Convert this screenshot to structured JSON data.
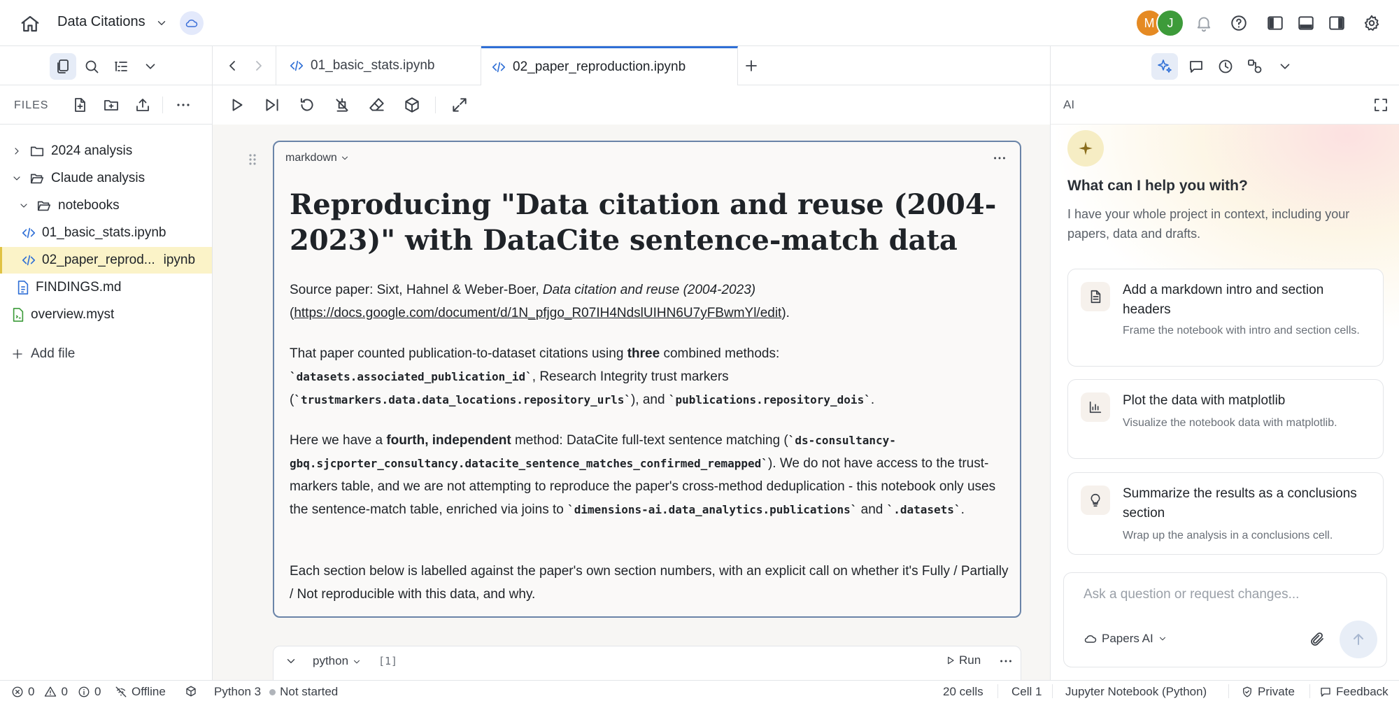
{
  "topbar": {
    "project_title": "Data Citations",
    "avatars": [
      "M",
      "J"
    ]
  },
  "sidebar": {
    "files_label": "FILES",
    "tree": [
      {
        "label": "2024 analysis",
        "type": "folder",
        "expanded": false
      },
      {
        "label": "Claude analysis",
        "type": "folder",
        "expanded": true
      },
      {
        "label": "notebooks",
        "type": "folder",
        "expanded": true
      },
      {
        "label": "01_basic_stats.ipynb",
        "type": "notebook"
      },
      {
        "label": "02_paper_reprod...",
        "suffix": "ipynb",
        "type": "notebook",
        "active": true
      },
      {
        "label": "FINDINGS.md",
        "type": "markdown"
      },
      {
        "label": "overview.myst",
        "type": "myst"
      }
    ],
    "add_file": "Add file"
  },
  "tabs": [
    {
      "label": "01_basic_stats.ipynb"
    },
    {
      "label": "02_paper_reproduction.ipynb",
      "active": true
    }
  ],
  "cell": {
    "type_label": "markdown",
    "heading": "Reproducing \"Data citation and reuse (2004-2023)\" with DataCite sentence-match data",
    "p1": {
      "prefix": "Source paper: Sixt, Hahnel & Weber-Boer, ",
      "italic": "Data citation and reuse (2004-2023)",
      "open": "(",
      "link": "https://docs.google.com/document/d/1N_pfjgo_R07IH4NdslUIHN6U7yFBwmYl/edit",
      "close": ")."
    },
    "p2": {
      "t1": "That paper counted publication-to-dataset citations using ",
      "b1": "three",
      "t2": " combined methods: ",
      "c1": "`datasets.associated_publication_id`",
      "t3": ", Research Integrity trust markers (",
      "c2": "`trustmarkers.data.data_locations.repository_urls`",
      "t4": "), and ",
      "c3": "`publications.repository_dois`",
      "t5": "."
    },
    "p3": {
      "t1": "Here we have a ",
      "b1": "fourth, independent",
      "t2": " method: DataCite full-text sentence matching (",
      "c1": "`ds-consultancy-gbq.sjcporter_consultancy.datacite_sentence_matches_confirmed_remapped`",
      "t3": "). We do not have access to the trust-markers table, and we are not attempting to reproduce the paper's cross-method deduplication - this notebook only uses the sentence-match table, enriched via joins to ",
      "c2": "`dimensions-ai.data_analytics.publications`",
      "t4": " and ",
      "c3": "`.datasets`",
      "t5": "."
    },
    "p4": "Each section below is labelled against the paper's own section numbers, with an explicit call on whether it's Fully / Partially / Not reproducible with this data, and why."
  },
  "code_cell": {
    "lang": "python",
    "count": "[1]",
    "run": "Run"
  },
  "ai": {
    "header": "AI",
    "question": "What can I help you with?",
    "intro": "I have your whole project in context, including your papers, data and drafts.",
    "suggestions": [
      {
        "title": "Add a markdown intro and section headers",
        "desc": "Frame the notebook with intro and section cells.",
        "icon": "document-icon"
      },
      {
        "title": "Plot the data with matplotlib",
        "desc": "Visualize the notebook data with matplotlib.",
        "icon": "chart-icon"
      },
      {
        "title": "Summarize the results as a conclusions section",
        "desc": "Wrap up the analysis in a conclusions cell.",
        "icon": "lightbulb-icon"
      }
    ],
    "input_placeholder": "Ask a question or request changes...",
    "model": "Papers AI"
  },
  "statusbar": {
    "errors": "0",
    "warnings": "0",
    "infos": "0",
    "offline": "Offline",
    "kernel": "Python 3",
    "kernel_state": "Not started",
    "cells": "20 cells",
    "cell_pos": "Cell 1",
    "nb_type": "Jupyter Notebook (Python)",
    "privacy": "Private",
    "feedback": "Feedback"
  }
}
